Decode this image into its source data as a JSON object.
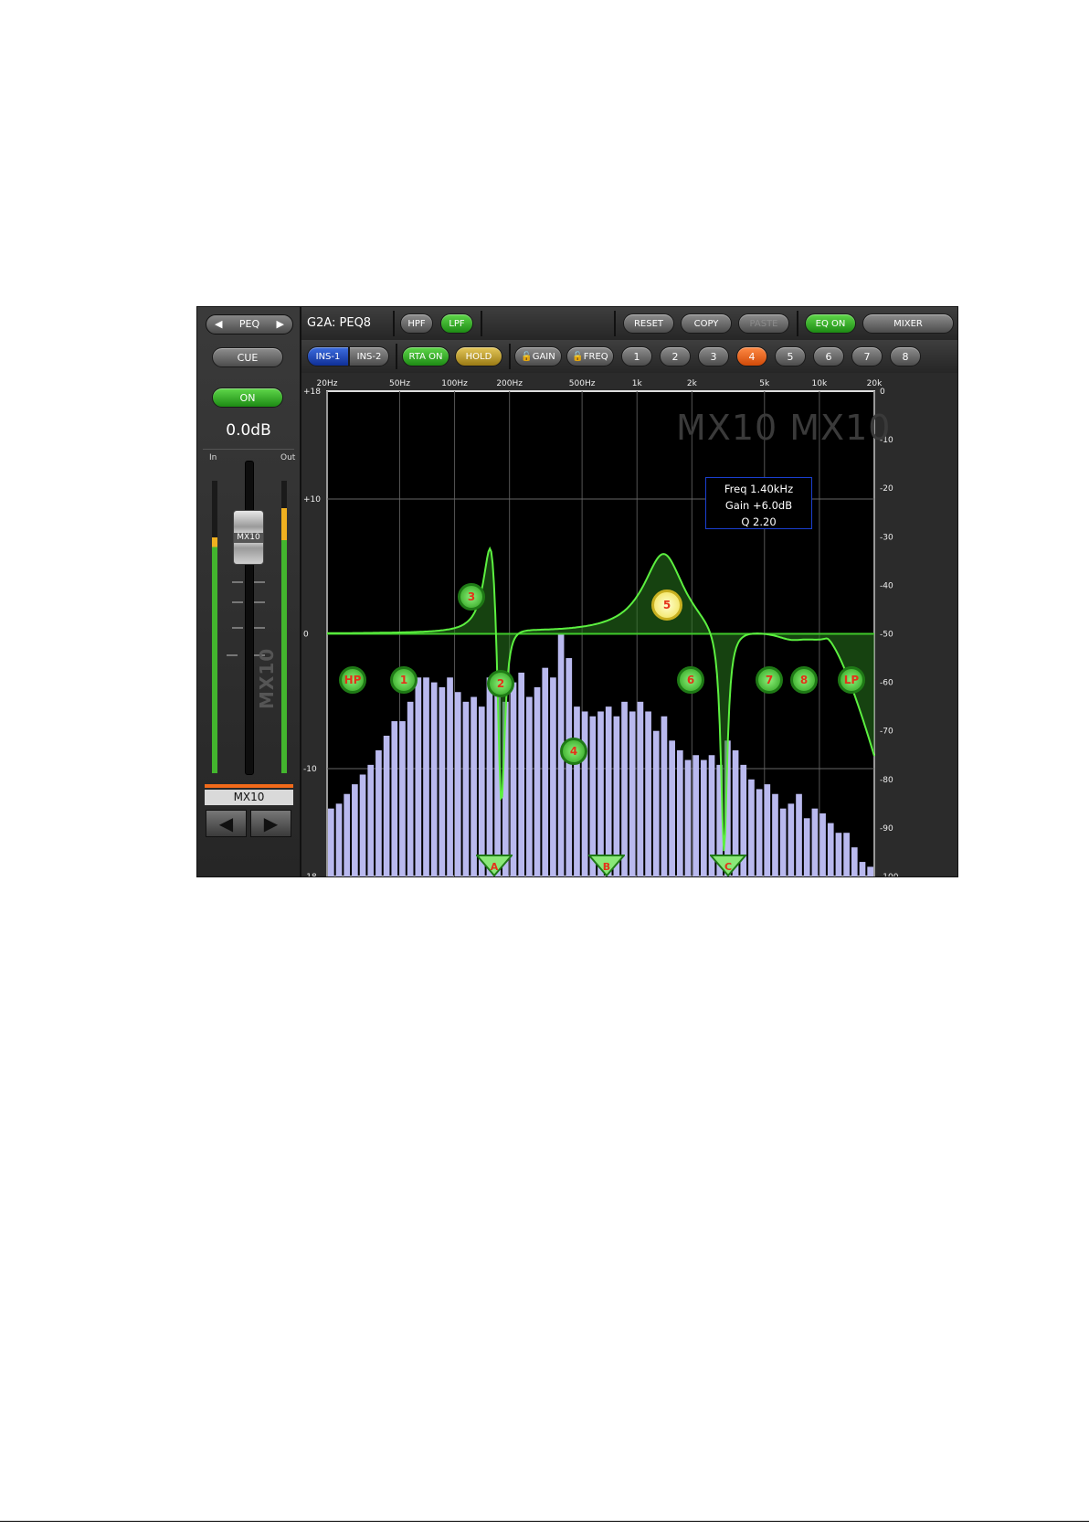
{
  "strip": {
    "peq_label": "PEQ",
    "cue_label": "CUE",
    "on_label": "ON",
    "level": "0.0dB",
    "meter_in_label": "In",
    "meter_out_label": "Out",
    "fader_label": "MX10",
    "vertical_label": "MX10",
    "channel_name": "MX10"
  },
  "toolbar": {
    "title": "G2A: PEQ8",
    "hpf": "HPF",
    "lpf": "LPF",
    "reset": "RESET",
    "copy": "COPY",
    "paste": "PASTE",
    "eq_on": "EQ ON",
    "mixer": "MIXER"
  },
  "toolbar2": {
    "ins1": "INS-1",
    "ins2": "INS-2",
    "rta_on": "RTA ON",
    "hold": "HOLD",
    "gain": "GAIN",
    "freq": "FREQ",
    "bands": [
      "1",
      "2",
      "3",
      "4",
      "5",
      "6",
      "7",
      "8"
    ],
    "selected_band": "4"
  },
  "graph": {
    "watermark": "MX10 MX10",
    "info": {
      "freq": "Freq  1.40kHz",
      "gain": "Gain +6.0dB",
      "q": "Q  2.20"
    },
    "freq_labels": [
      "20Hz",
      "50Hz",
      "100Hz",
      "200Hz",
      "500Hz",
      "1k",
      "2k",
      "5k",
      "10k",
      "20k"
    ],
    "gain_labels": [
      "+18",
      "+10",
      "0",
      "-10",
      "-18"
    ],
    "rta_labels": [
      "0",
      "-10",
      "-20",
      "-30",
      "-40",
      "-50",
      "-60",
      "-70",
      "-80",
      "-90",
      "-100"
    ],
    "eq_points": [
      "HP",
      "1",
      "3",
      "2",
      "4",
      "5",
      "6",
      "7",
      "8",
      "LP"
    ],
    "notch_markers": [
      "A",
      "B",
      "C"
    ]
  },
  "chart_data": {
    "type": "bar",
    "title": "",
    "xlabel": "",
    "ylabel": "",
    "ylim": [
      -100,
      0
    ],
    "x_scale": "log",
    "xlim_hz": [
      20,
      20000
    ],
    "series": [
      {
        "values": [
          -86,
          -85,
          -83,
          -81,
          -79,
          -77,
          -74,
          -71,
          -68,
          -68,
          -64,
          -59,
          -59,
          -60,
          -61,
          -59,
          -62,
          -64,
          -63,
          -65,
          -59,
          -62,
          -64,
          -60,
          -58,
          -63,
          -61,
          -57,
          -59,
          -50,
          -55,
          -65,
          -66,
          -67,
          -66,
          -65,
          -67,
          -64,
          -66,
          -64,
          -66,
          -70,
          -67,
          -72,
          -74,
          -76,
          -75,
          -76,
          -75,
          -77,
          -72,
          -74,
          -77,
          -80,
          -82,
          -81,
          -83,
          -86,
          -85,
          -83,
          -88,
          -86,
          -87,
          -89,
          -91,
          -91,
          -94,
          -97,
          -98
        ]
      }
    ],
    "eq_curve_gain_db": {
      "min": -18,
      "max": 18
    }
  },
  "colors": {
    "accent_green": "#3fc82a",
    "selected_band": "#f26a1a",
    "rta_bars": "#b9b9ee"
  }
}
